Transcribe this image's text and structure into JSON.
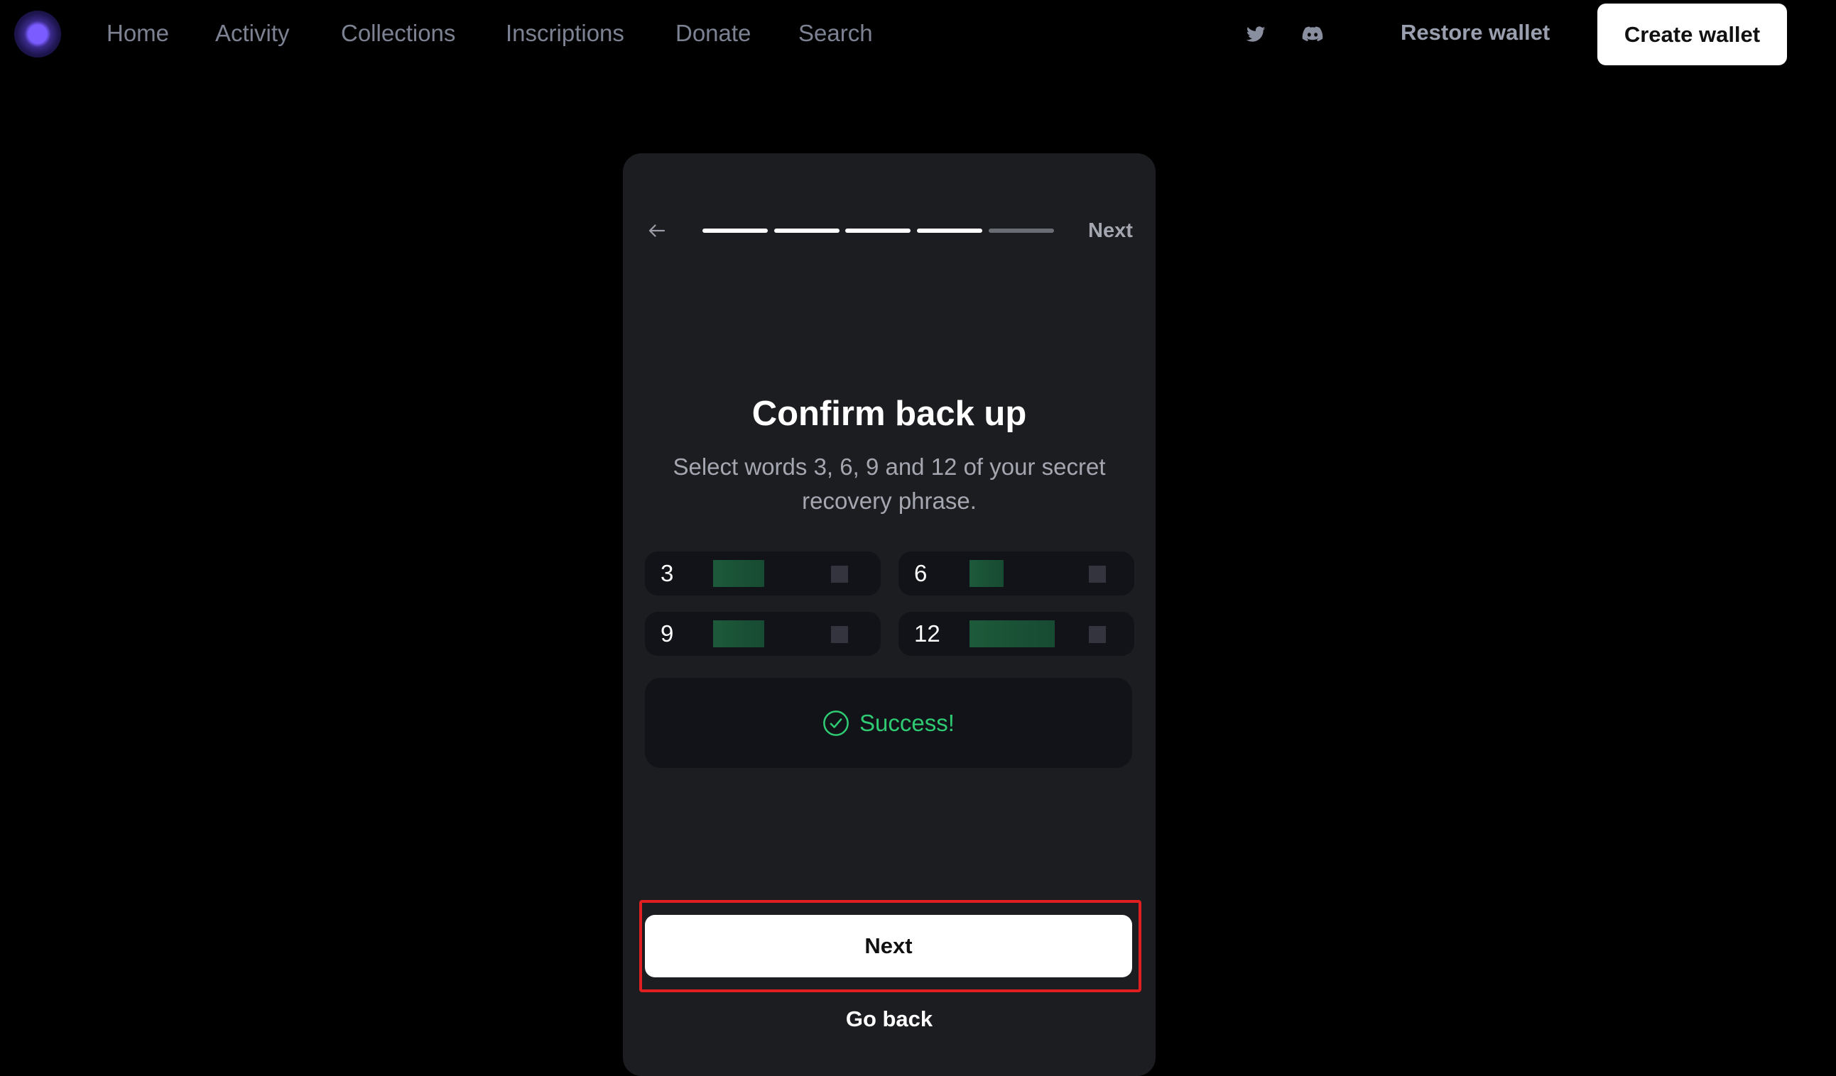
{
  "nav": {
    "items": [
      "Home",
      "Activity",
      "Collections",
      "Inscriptions",
      "Donate",
      "Search"
    ],
    "restore": "Restore wallet",
    "create": "Create wallet"
  },
  "icons": {
    "logo": "logo",
    "social": [
      "twitter-icon",
      "discord-icon"
    ],
    "back": "arrow-left-icon",
    "success": "check-circle-icon"
  },
  "card": {
    "progress": {
      "steps": 5,
      "completed": 4
    },
    "next_top": "Next",
    "title": "Confirm back up",
    "subtitle_line1": "Select words 3, 6, 9 and 12 of your secret",
    "subtitle_line2": "recovery phrase.",
    "words": [
      {
        "index": "3"
      },
      {
        "index": "6"
      },
      {
        "index": "9"
      },
      {
        "index": "12"
      }
    ],
    "success": "Success!",
    "next": "Next",
    "go_back": "Go back"
  },
  "colors": {
    "success": "#2fcb73",
    "highlight": "#e02020",
    "card": "#1c1d21"
  }
}
